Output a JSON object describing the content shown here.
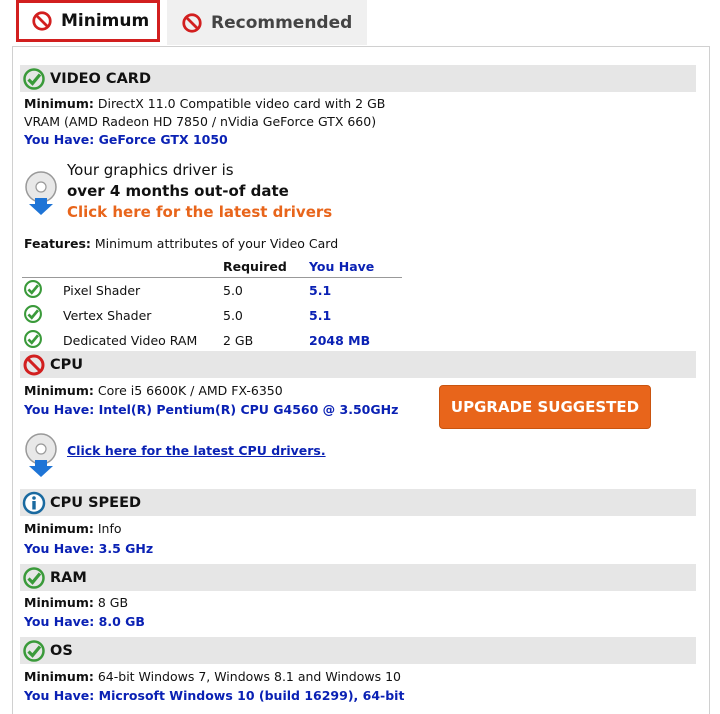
{
  "tabs": {
    "minimum": "Minimum",
    "recommended": "Recommended"
  },
  "labels": {
    "minimum": "Minimum:",
    "you_have": "You Have:",
    "features": "Features:"
  },
  "video_card": {
    "title": "VIDEO CARD",
    "minimum": "DirectX 11.0 Compatible video card with 2 GB",
    "minimum2": "VRAM (AMD Radeon HD 7850 / nVidia GeForce GTX 660)",
    "you_have": "GeForce GTX 1050",
    "driver_line1": "Your graphics driver is",
    "driver_line2": "over 4 months out-of date",
    "driver_link": "Click here for the latest drivers",
    "features_desc": "Minimum attributes of your Video Card",
    "table": {
      "headers": [
        "",
        "",
        "Required",
        "You Have"
      ],
      "rows": [
        {
          "name": "Pixel Shader",
          "required": "5.0",
          "have": "5.1"
        },
        {
          "name": "Vertex Shader",
          "required": "5.0",
          "have": "5.1"
        },
        {
          "name": "Dedicated Video RAM",
          "required": "2 GB",
          "have": "2048 MB"
        }
      ]
    }
  },
  "cpu": {
    "title": "CPU",
    "minimum": "Core i5 6600K / AMD FX-6350",
    "you_have": "Intel(R) Pentium(R) CPU G4560 @ 3.50GHz",
    "upgrade": "UPGRADE SUGGESTED",
    "driver_link": "Click here for the latest CPU drivers."
  },
  "cpu_speed": {
    "title": "CPU SPEED",
    "minimum": "Info",
    "you_have": "3.5 GHz"
  },
  "ram": {
    "title": "RAM",
    "minimum": "8 GB",
    "you_have": "8.0 GB"
  },
  "os": {
    "title": "OS",
    "minimum": "64-bit Windows 7, Windows 8.1 and Windows 10",
    "you_have": "Microsoft Windows 10 (build 16299), 64-bit"
  },
  "colors": {
    "pass": "#3a9a3a",
    "fail": "#d21f1f",
    "info": "#1a6aa0",
    "link": "#0a21b4",
    "accent": "#e8651b"
  }
}
